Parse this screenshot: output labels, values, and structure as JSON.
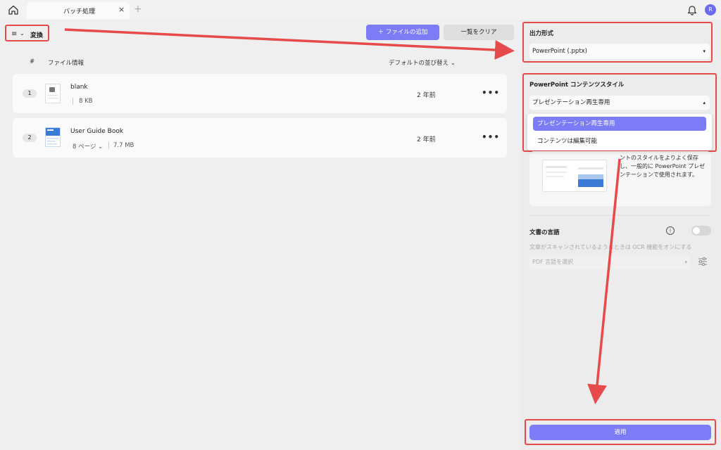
{
  "titlebar": {
    "tab_title": "バッチ処理",
    "close_glyph": "×",
    "new_tab_glyph": "+",
    "avatar_initial": "R"
  },
  "toolbar": {
    "menu_icon": "≡",
    "chevron": "⌄",
    "mode_label": "変換",
    "add_files_label": "＋ ファイルの追加",
    "clear_list_label": "一覧をクリア"
  },
  "table": {
    "headers": {
      "index": "#",
      "file_info": "ファイル情報",
      "sort": "デフォルトの並び替え ⌄"
    },
    "rows": [
      {
        "index": "1",
        "name": "blank",
        "pages": "",
        "size": "8 KB",
        "time": "2 年前",
        "more": "•••"
      },
      {
        "index": "2",
        "name": "User Guide Book",
        "pages": "8 ページ ⌄",
        "size": "7.7 MB",
        "time": "2 年前",
        "more": "•••"
      }
    ]
  },
  "panel": {
    "output_format": {
      "title": "出力形式",
      "value": "PowerPoint (.pptx)",
      "caret": "▾"
    },
    "content_style": {
      "title": "PowerPoint コンテンツスタイル",
      "value": "プレゼンテーション再生専用",
      "caret": "▴",
      "options": [
        "プレゼンテーション再生専用",
        "コンテンツは編集可能"
      ],
      "selected_index": 0
    },
    "preview_text": "ントのスタイルをよりよく保存し、一般的に PowerPoint プレゼンテーションで使用されます。",
    "document_language": {
      "title": "文書の言語",
      "info_glyph": "i",
      "hint": "文章がスキャンされているようなときは OCR 機能をオンにする",
      "select_placeholder": "PDF 言語を選択",
      "caret": "▾",
      "ocr_enabled": false
    },
    "apply_label": "適用"
  },
  "colors": {
    "accent": "#7c7cf6",
    "annotation": "#e64a4a"
  },
  "icons": [
    "home-icon",
    "close-icon",
    "plus-icon",
    "bell-icon",
    "menu-icon",
    "chevron-down-icon",
    "more-icon",
    "info-icon",
    "settings-sliders-icon",
    "file-icon"
  ]
}
